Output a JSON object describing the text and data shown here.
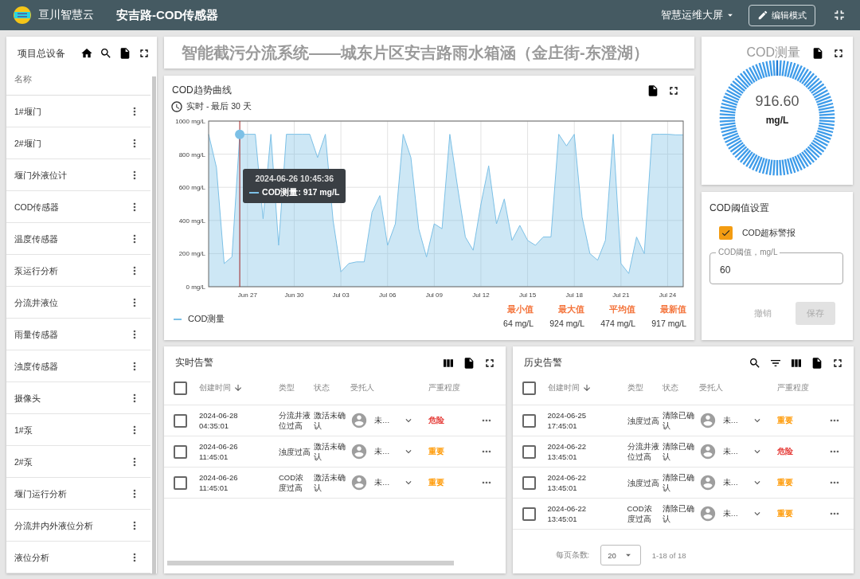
{
  "header": {
    "brand": "亘川智慧云",
    "title": "安吉路-COD传感器",
    "dashboard_menu": "智慧运维大屏",
    "edit_button": "编辑模式"
  },
  "sidebar": {
    "title": "项目总设备",
    "column": "名称",
    "items": [
      {
        "label": "1#堰门"
      },
      {
        "label": "2#堰门"
      },
      {
        "label": "堰门外液位计"
      },
      {
        "label": "COD传感器"
      },
      {
        "label": "温度传感器"
      },
      {
        "label": "泵运行分析"
      },
      {
        "label": "分流井液位"
      },
      {
        "label": "雨量传感器"
      },
      {
        "label": "浊度传感器"
      },
      {
        "label": "摄像头"
      },
      {
        "label": "1#泵"
      },
      {
        "label": "2#泵"
      },
      {
        "label": "堰门运行分析"
      },
      {
        "label": "分流井内外液位分析"
      },
      {
        "label": "液位分析"
      }
    ]
  },
  "banner": {
    "title": "智能截污分流系统——城东片区安吉路雨水箱涵（金庄街-东澄湖）"
  },
  "chart": {
    "title": "COD趋势曲线",
    "subtitle": "实时 - 最后 30 天",
    "tooltip": {
      "title": "2024-06-26 10:45:36",
      "label": "COD测量:",
      "value": "917 mg/L"
    },
    "chart_data": {
      "type": "area",
      "grid": true,
      "categories": [
        null,
        null,
        null,
        null,
        null,
        "Jun 27",
        null,
        null,
        null,
        null,
        null,
        "Jun 30",
        null,
        null,
        null,
        null,
        null,
        "Jul 03",
        null,
        null,
        null,
        null,
        null,
        "Jul 06",
        null,
        null,
        null,
        null,
        null,
        "Jul 09",
        null,
        null,
        null,
        null,
        null,
        "Jul 12",
        null,
        null,
        null,
        null,
        null,
        "Jul 15",
        null,
        null,
        null,
        null,
        null,
        "Jul 18",
        null,
        null,
        null,
        null,
        null,
        "Jul 21",
        null,
        null,
        null,
        null,
        null,
        "Jul 24",
        null,
        null
      ],
      "series": [
        {
          "name": "COD测量",
          "color": "#7cc0e6",
          "values": [
            920,
            720,
            140,
            180,
            920,
            920,
            920,
            410,
            920,
            250,
            920,
            920,
            920,
            920,
            780,
            920,
            400,
            90,
            140,
            150,
            150,
            450,
            550,
            250,
            380,
            920,
            780,
            350,
            180,
            380,
            350,
            920,
            600,
            300,
            220,
            500,
            730,
            380,
            530,
            280,
            370,
            280,
            250,
            300,
            300,
            920,
            850,
            920,
            420,
            200,
            160,
            280,
            920,
            140,
            80,
            300,
            200,
            920,
            920,
            920,
            917,
            917
          ]
        }
      ],
      "ylim": [
        0,
        1000
      ],
      "yticks": [
        {
          "value": 0,
          "label": "0 mg/L"
        },
        {
          "value": 200,
          "label": "200 mg/L"
        },
        {
          "value": 400,
          "label": "400 mg/L"
        },
        {
          "value": 600,
          "label": "600 mg/L"
        },
        {
          "value": 800,
          "label": "800 mg/L"
        },
        {
          "value": 1000,
          "label": "1000 mg/L"
        }
      ]
    },
    "stats": [
      {
        "label": "最小值",
        "value": "64 mg/L"
      },
      {
        "label": "最大值",
        "value": "924 mg/L"
      },
      {
        "label": "平均值",
        "value": "474 mg/L"
      },
      {
        "label": "最新值",
        "value": "917 mg/L"
      }
    ]
  },
  "gauge": {
    "title": "COD测量",
    "value": "916.60",
    "unit": "mg/L"
  },
  "threshold": {
    "title": "COD阈值设置",
    "alarm_checkbox": {
      "label": "COD超标警报",
      "checked": true
    },
    "field": {
      "label": "COD阈值，mg/L",
      "value": "60"
    },
    "buttons": [
      {
        "label": "撤销",
        "kind": "text",
        "disabled": true
      },
      {
        "label": "保存",
        "kind": "filled",
        "disabled": true
      }
    ]
  },
  "alarm_tables": [
    {
      "title": "实时告警",
      "columns": [
        "创建时间",
        "类型",
        "状态",
        "受托人",
        "严重程度"
      ],
      "header_checked": false,
      "rows": [
        {
          "checked": false,
          "date": "2024-06-28",
          "time": "04:35:01",
          "type": "分流井液位过高",
          "status": "激活未确认",
          "assignee": "未…",
          "severity": "危险",
          "color": "#e53935"
        },
        {
          "checked": false,
          "date": "2024-06-26",
          "time": "11:45:01",
          "type": "浊度过高",
          "status": "激活未确认",
          "assignee": "未…",
          "severity": "重要",
          "color": "#ff9800"
        },
        {
          "checked": false,
          "date": "2024-06-26",
          "time": "11:45:01",
          "type": "COD浓度过高",
          "status": "激活未确认",
          "assignee": "未…",
          "severity": "重要",
          "color": "#ff9800"
        }
      ]
    },
    {
      "title": "历史告警",
      "columns": [
        "创建时间",
        "类型",
        "状态",
        "受托人",
        "严重程度"
      ],
      "header_checked": false,
      "rows": [
        {
          "checked": false,
          "date": "2024-06-25",
          "time": "17:45:01",
          "type": "浊度过高",
          "status": "清除已确认",
          "assignee": "未…",
          "severity": "重要",
          "color": "#ff9800"
        },
        {
          "checked": false,
          "date": "2024-06-22",
          "time": "13:45:01",
          "type": "分流井液位过高",
          "status": "清除已确认",
          "assignee": "未…",
          "severity": "危险",
          "color": "#e53935"
        },
        {
          "checked": false,
          "date": "2024-06-22",
          "time": "13:45:01",
          "type": "浊度过高",
          "status": "清除已确认",
          "assignee": "未…",
          "severity": "重要",
          "color": "#ff9800"
        },
        {
          "checked": false,
          "date": "2024-06-22",
          "time": "13:45:01",
          "type": "COD浓度过高",
          "status": "清除已确认",
          "assignee": "未…",
          "severity": "重要",
          "color": "#ff9800"
        }
      ],
      "pagination": {
        "label": "每页条数:",
        "page_size": "20",
        "range": "1-18 of 18"
      }
    }
  ]
}
